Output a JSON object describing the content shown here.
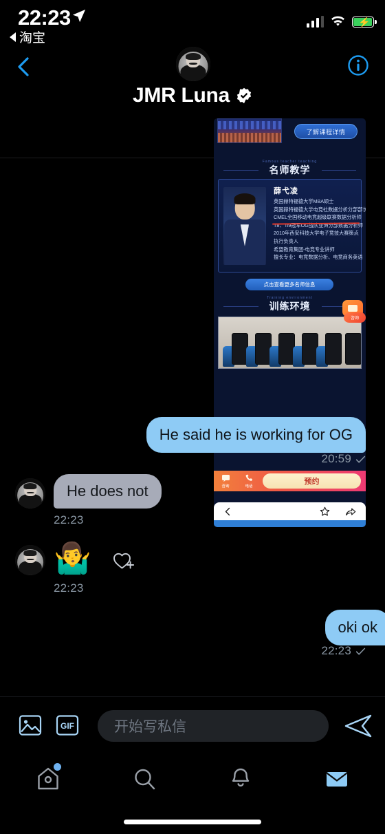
{
  "status_bar": {
    "time": "22:23",
    "location_icon": "location-arrow-icon",
    "back_app_label": "淘宝",
    "signal_icon": "cellular-signal-icon",
    "wifi_icon": "wifi-icon",
    "battery_icon": "battery-charging-icon"
  },
  "header": {
    "back_icon": "chevron-left-icon",
    "avatar_icon": "user-avatar",
    "title": "JMR Luna",
    "verified_icon": "verified-badge-icon",
    "info_icon": "info-circle-icon",
    "accent_blue": "#1d9bf0"
  },
  "link_preview": {
    "cta_top_label": "了解课程详情",
    "section_1_title": "名师教学",
    "section_1_sub": "Famous teacher teaching",
    "section_2_title": "训练环境",
    "section_2_sub": "Training environment",
    "teacher_name": "薛弋凌",
    "credentials": [
      "英国赫特福德大学MBA硕士",
      "英国赫特福德大学电竞社数据分析分部部长",
      "CMEL全国移动电竞超级联赛数据分析师",
      "T8、Ti9冠军OG战队亚洲分部数据分析师",
      "2010年西安科技大学电子竞技大赛策点",
      "执行负责人",
      "希望教育集团-电竞专业讲师",
      "擅长专业：电竞数据分析、电竞商务英语"
    ],
    "cta_more_label": "点击查看更多名师信息",
    "float_button_label": "咨询",
    "bottom_bar": {
      "consult_label": "咨询",
      "consult_icon": "chat-bubble-icon",
      "phone_label": "电话",
      "phone_icon": "phone-icon",
      "reserve_label": "预约"
    },
    "browser_nav": {
      "back_icon": "chevron-left-icon",
      "favorite_icon": "star-icon",
      "share_icon": "share-arrow-icon"
    }
  },
  "messages": [
    {
      "id": "m1",
      "direction": "outgoing",
      "text": "He said he is working for OG",
      "time": "20:59",
      "status_icon": "check-icon"
    },
    {
      "id": "m2",
      "direction": "incoming",
      "text": "He does not",
      "time": "22:23",
      "avatar_icon": "user-avatar"
    },
    {
      "id": "m3",
      "direction": "incoming",
      "type": "emoji",
      "text": "🤷‍♂️",
      "time": "22:23",
      "avatar_icon": "user-avatar",
      "reaction_icon": "heart-plus-icon"
    },
    {
      "id": "m4",
      "direction": "outgoing",
      "text": "oki ok",
      "time": "22:23",
      "status_icon": "check-icon"
    }
  ],
  "composer": {
    "photo_icon": "image-icon",
    "gif_icon": "gif-icon",
    "gif_label": "GIF",
    "placeholder": "开始写私信",
    "value": "",
    "send_icon": "send-arrow-icon"
  },
  "tab_bar": {
    "items": [
      {
        "name": "home",
        "icon": "home-birdhouse-icon",
        "active": false,
        "badge": true
      },
      {
        "name": "search",
        "icon": "search-icon",
        "active": false,
        "badge": false
      },
      {
        "name": "notifications",
        "icon": "bell-icon",
        "active": false,
        "badge": false
      },
      {
        "name": "messages",
        "icon": "envelope-icon",
        "active": true,
        "badge": false
      }
    ]
  },
  "colors": {
    "background": "#000000",
    "outgoing_bubble": "#8ecbf5",
    "incoming_bubble": "#a7abb8",
    "timestamp": "#8b98a5",
    "accent": "#1d9bf0"
  }
}
